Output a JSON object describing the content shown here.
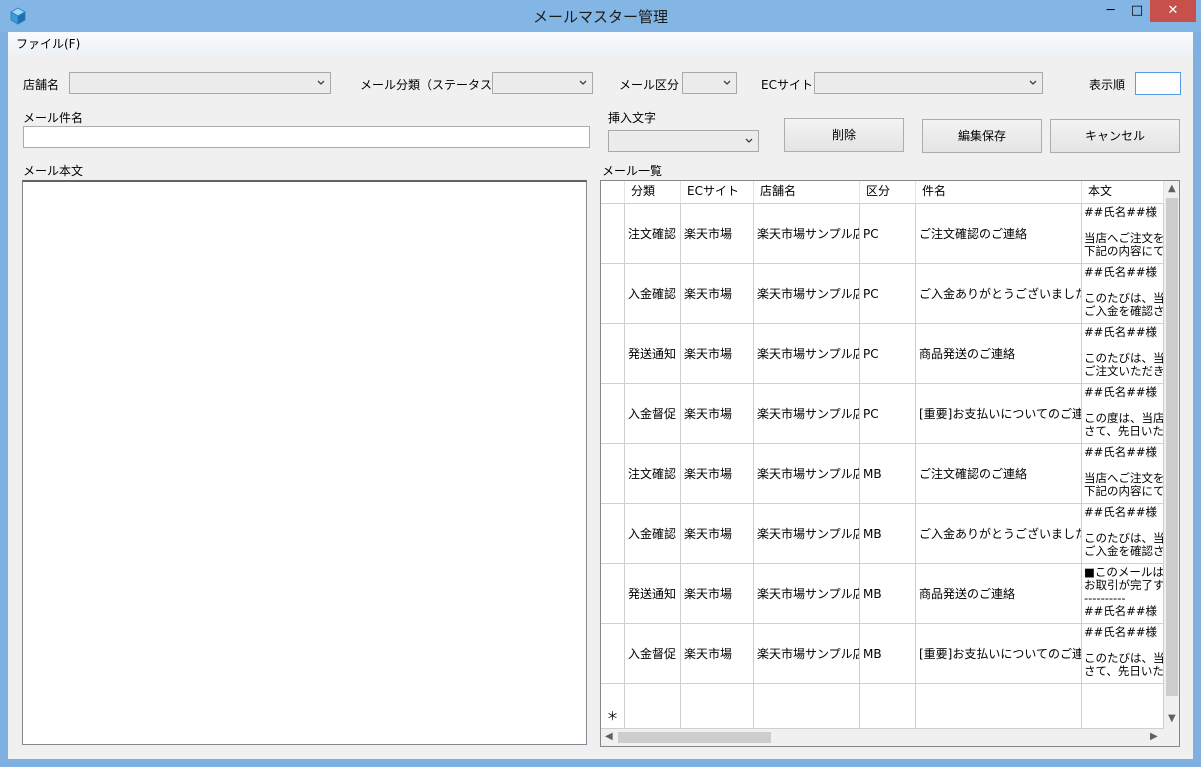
{
  "window": {
    "title": "メールマスター管理",
    "icon": "app-cube-icon",
    "caption": {
      "minimize": "─",
      "maximize": "□",
      "close": "✕"
    },
    "colors": {
      "frame": "#7eb1e2",
      "close": "#c7504b"
    }
  },
  "menu": {
    "file_label": "ファイル(F)"
  },
  "filters": {
    "shop_label": "店舗名",
    "shop_value": "",
    "mail_category_label": "メール分類（ステータス）",
    "mail_category_value": "",
    "mail_type_label": "メール区分",
    "mail_type_value": "",
    "ec_site_label": "ECサイト",
    "ec_site_value": "",
    "display_order_label": "表示順",
    "display_order_value": ""
  },
  "form": {
    "subject_label": "メール件名",
    "subject_value": "",
    "insert_text_label": "挿入文字",
    "insert_text_value": "",
    "body_label": "メール本文",
    "body_value": "",
    "list_label": "メール一覧"
  },
  "buttons": {
    "delete": "削除",
    "save": "編集保存",
    "cancel": "キャンセル"
  },
  "grid": {
    "columns": [
      "分類",
      "ECサイト",
      "店舗名",
      "区分",
      "件名",
      "本文"
    ],
    "new_row_marker": "＊",
    "rows": [
      [
        "注文確認",
        "楽天市場",
        "楽天市場サンプル店",
        "PC",
        "ご注文確認のご連絡",
        "##氏名##様\n\n当店へご注文を\n下記の内容にて"
      ],
      [
        "入金確認",
        "楽天市場",
        "楽天市場サンプル店",
        "PC",
        "ご入金ありがとうございました",
        "##氏名##様\n\nこのたびは、当店\nご入金を確認さ"
      ],
      [
        "発送通知",
        "楽天市場",
        "楽天市場サンプル店",
        "PC",
        "商品発送のご連絡",
        "##氏名##様\n\nこのたびは、当店\nご注文いただきま"
      ],
      [
        "入金督促",
        "楽天市場",
        "楽天市場サンプル店",
        "PC",
        "[重要]お支払いについてのご連絡",
        "##氏名##様\n\nこの度は、当店を\nさて、先日いただ"
      ],
      [
        "注文確認",
        "楽天市場",
        "楽天市場サンプル店",
        "MB",
        "ご注文確認のご連絡",
        "##氏名##様\n\n当店へご注文を\n下記の内容にて"
      ],
      [
        "入金確認",
        "楽天市場",
        "楽天市場サンプル店",
        "MB",
        "ご入金ありがとうございました",
        "##氏名##様\n\nこのたびは、当店\nご入金を確認さ"
      ],
      [
        "発送通知",
        "楽天市場",
        "楽天市場サンプル店",
        "MB",
        "商品発送のご連絡",
        "■このメールはお\nお取引が完了す\n----------\n##氏名##様"
      ],
      [
        "入金督促",
        "楽天市場",
        "楽天市場サンプル店",
        "MB",
        "[重要]お支払いについてのご連絡",
        "##氏名##様\n\nこのたびは、当店\nさて、先日いただ"
      ]
    ]
  }
}
